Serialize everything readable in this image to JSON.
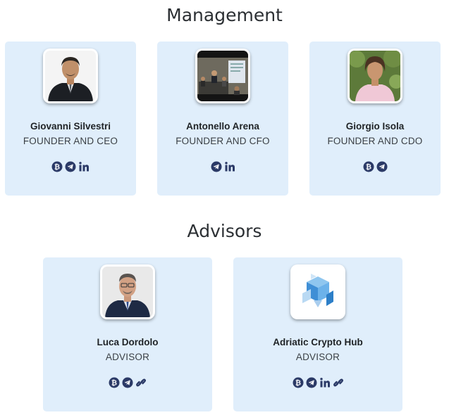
{
  "management": {
    "title": "Management",
    "members": [
      {
        "name": "Giovanni Silvestri",
        "role": "FOUNDER AND CEO",
        "socials": [
          "bitcointalk-icon",
          "telegram-icon",
          "linkedin-icon"
        ]
      },
      {
        "name": "Antonello Arena",
        "role": "FOUNDER AND CFO",
        "socials": [
          "telegram-icon",
          "linkedin-icon"
        ]
      },
      {
        "name": "Giorgio Isola",
        "role": "FOUNDER AND CDO",
        "socials": [
          "bitcointalk-icon",
          "telegram-icon"
        ]
      }
    ]
  },
  "advisors": {
    "title": "Advisors",
    "members": [
      {
        "name": "Luca Dordolo",
        "role": "ADVISOR",
        "socials": [
          "bitcointalk-icon",
          "telegram-icon",
          "link-icon"
        ]
      },
      {
        "name": "Adriatic Crypto Hub",
        "role": "ADVISOR",
        "socials": [
          "bitcointalk-icon",
          "telegram-icon",
          "linkedin-icon",
          "link-icon"
        ]
      }
    ]
  },
  "colors": {
    "card_bg": "#e0eefb",
    "icon": "#2b3a67"
  }
}
